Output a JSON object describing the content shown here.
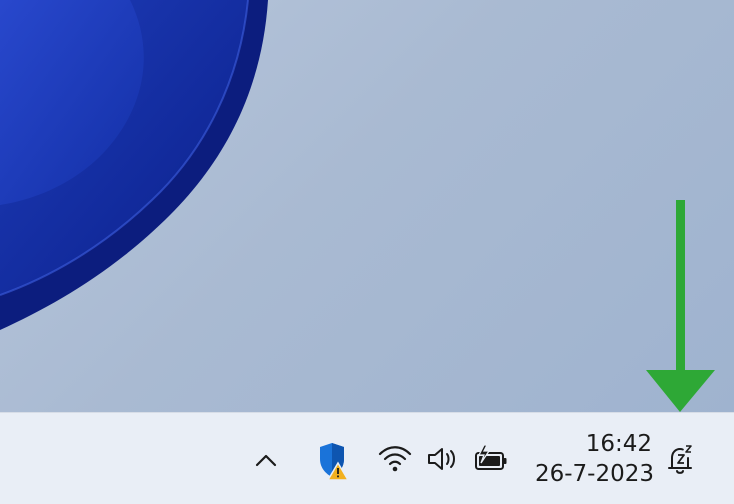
{
  "desktop": {
    "wallpaper": "windows-11-bloom-wallpaper"
  },
  "annotation": {
    "arrow_icon": "green-down-arrow-icon",
    "arrow_color": "#2ea836"
  },
  "taskbar": {
    "background": "#e9eef6",
    "tray": {
      "items": [
        {
          "icon": "chevron-up-icon"
        },
        {
          "icon": "windows-security-warning-icon"
        },
        {
          "icon": "wifi-icon"
        },
        {
          "icon": "speaker-icon"
        },
        {
          "icon": "battery-charging-icon"
        }
      ]
    },
    "clock": {
      "time": "16:42",
      "date": "26-7-2023"
    },
    "notifications": {
      "icon": "bell-snooze-icon"
    }
  }
}
